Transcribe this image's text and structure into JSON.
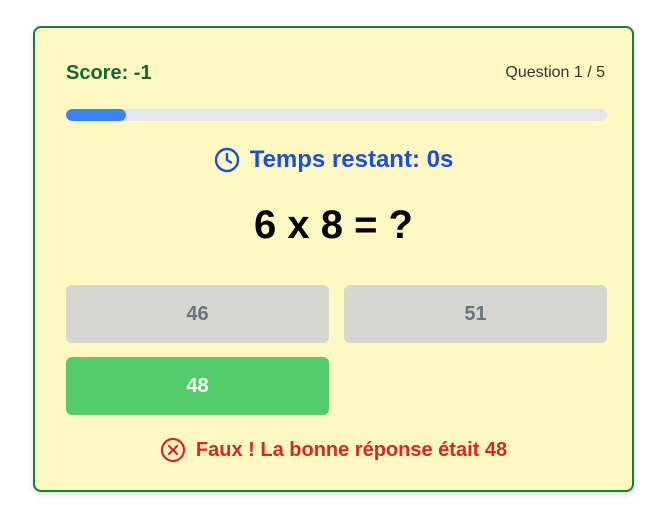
{
  "header": {
    "score_label": "Score: -1",
    "question_counter": "Question 1 / 5"
  },
  "progress": {
    "current": 1,
    "total": 5,
    "fraction": 0.11
  },
  "timer": {
    "icon": "clock-icon",
    "text": "Temps restant: 0s"
  },
  "question": {
    "text": "6 x 8 = ?"
  },
  "answers": [
    {
      "label": "46",
      "state": "disabled"
    },
    {
      "label": "51",
      "state": "disabled"
    },
    {
      "label": "48",
      "state": "correct"
    }
  ],
  "feedback": {
    "icon": "x-circle-icon",
    "text": "Faux ! La bonne réponse était 48"
  },
  "colors": {
    "card_background": "#fef9c3",
    "card_border": "#15803d",
    "progress_fill": "#3b82f6",
    "timer_text": "#1d4ed8",
    "correct_answer": "#55cc6a",
    "error_text": "#dc2626"
  }
}
